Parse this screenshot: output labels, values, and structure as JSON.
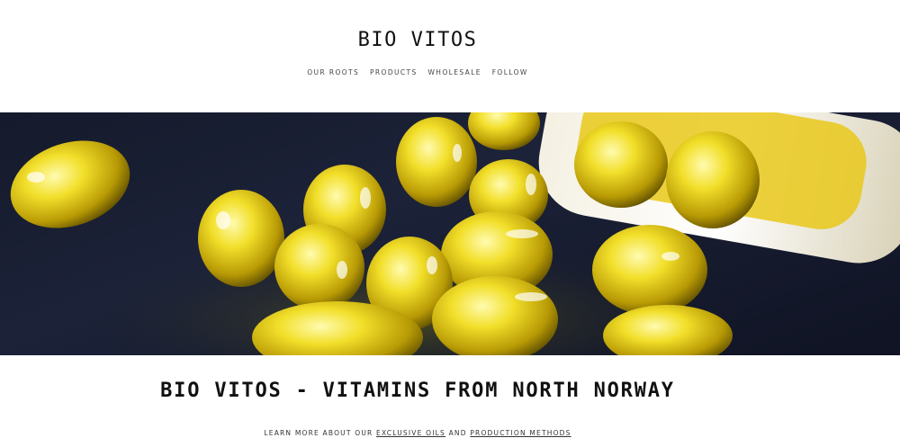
{
  "header": {
    "brand": "BIO VITOS",
    "nav": [
      {
        "label": "OUR ROOTS"
      },
      {
        "label": "PRODUCTS"
      },
      {
        "label": "WHOLESALE"
      },
      {
        "label": "FOLLOW"
      }
    ]
  },
  "hero": {
    "image": "fish-oil-capsules-spilling-from-bottle",
    "colors": {
      "capsule": "#e8d21a",
      "background": "#1a1f33"
    }
  },
  "main": {
    "headline": "BIO VITOS - VITAMINS FROM NORTH NORWAY",
    "subline": {
      "prefix": "LEARN MORE ABOUT OUR",
      "link1": "EXCLUSIVE OILS",
      "middle": "AND",
      "link2": "PRODUCTION METHODS"
    }
  }
}
